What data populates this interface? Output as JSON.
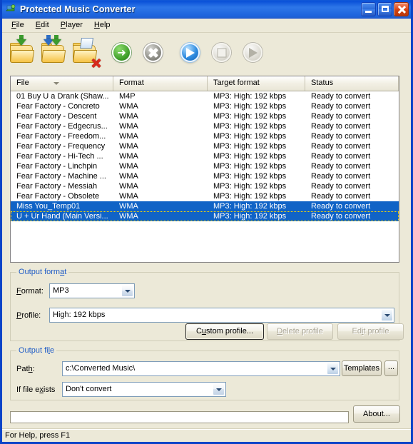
{
  "window": {
    "title": "Protected Music Converter",
    "icon": "app-converter-icon",
    "minimize_label": "Minimize",
    "maximize_label": "Maximize",
    "close_label": "Close"
  },
  "menu": {
    "items": [
      {
        "label": "File",
        "accel": "F"
      },
      {
        "label": "Edit",
        "accel": "E"
      },
      {
        "label": "Player",
        "accel": "P"
      },
      {
        "label": "Help",
        "accel": "H"
      }
    ]
  },
  "toolbar": {
    "buttons": [
      {
        "name": "add-files-icon",
        "tooltip": "Add files"
      },
      {
        "name": "add-folder-icon",
        "tooltip": "Add folder"
      },
      {
        "name": "remove-files-icon",
        "tooltip": "Remove files"
      },
      {
        "name": "convert-icon",
        "tooltip": "Convert"
      },
      {
        "name": "cancel-icon",
        "tooltip": "Cancel"
      },
      {
        "name": "play-icon",
        "tooltip": "Play"
      },
      {
        "name": "stop-icon",
        "tooltip": "Stop"
      },
      {
        "name": "pause-icon",
        "tooltip": "Pause"
      }
    ]
  },
  "file_list": {
    "columns": [
      "File",
      "Format",
      "Target format",
      "Status"
    ],
    "sort_column": "File",
    "sort_direction": "descending",
    "rows": [
      {
        "file": "01 Buy U a Drank (Shaw...",
        "format": "M4P",
        "target": "MP3: High: 192 kbps",
        "status": "Ready to convert",
        "selected": false
      },
      {
        "file": "Fear Factory - Concreto",
        "format": "WMA",
        "target": "MP3: High: 192 kbps",
        "status": "Ready to convert",
        "selected": false
      },
      {
        "file": "Fear Factory - Descent",
        "format": "WMA",
        "target": "MP3: High: 192 kbps",
        "status": "Ready to convert",
        "selected": false
      },
      {
        "file": "Fear Factory - Edgecrus...",
        "format": "WMA",
        "target": "MP3: High: 192 kbps",
        "status": "Ready to convert",
        "selected": false
      },
      {
        "file": "Fear Factory - Freedom...",
        "format": "WMA",
        "target": "MP3: High: 192 kbps",
        "status": "Ready to convert",
        "selected": false
      },
      {
        "file": "Fear Factory - Frequency",
        "format": "WMA",
        "target": "MP3: High: 192 kbps",
        "status": "Ready to convert",
        "selected": false
      },
      {
        "file": "Fear Factory - Hi-Tech ...",
        "format": "WMA",
        "target": "MP3: High: 192 kbps",
        "status": "Ready to convert",
        "selected": false
      },
      {
        "file": "Fear Factory - Linchpin",
        "format": "WMA",
        "target": "MP3: High: 192 kbps",
        "status": "Ready to convert",
        "selected": false
      },
      {
        "file": "Fear Factory - Machine ...",
        "format": "WMA",
        "target": "MP3: High: 192 kbps",
        "status": "Ready to convert",
        "selected": false
      },
      {
        "file": "Fear Factory - Messiah",
        "format": "WMA",
        "target": "MP3: High: 192 kbps",
        "status": "Ready to convert",
        "selected": false
      },
      {
        "file": "Fear Factory - Obsolete",
        "format": "WMA",
        "target": "MP3: High: 192 kbps",
        "status": "Ready to convert",
        "selected": false
      },
      {
        "file": "Miss You_Temp01",
        "format": "WMA",
        "target": "MP3: High: 192 kbps",
        "status": "Ready to convert",
        "selected": true
      },
      {
        "file": "U + Ur Hand (Main Versi...",
        "format": "WMA",
        "target": "MP3: High: 192 kbps",
        "status": "Ready to convert",
        "selected": true
      }
    ]
  },
  "output_format": {
    "legend": "Output format",
    "legend_accel": "a",
    "format_label": "Format:",
    "format_accel": "F",
    "format_value": "MP3",
    "profile_label": "Profile:",
    "profile_accel": "P",
    "profile_value": "High: 192 kbps",
    "custom_profile_button": "Custom profile...",
    "custom_profile_accel": "u",
    "delete_profile_button": "Delete profile",
    "delete_profile_accel": "D",
    "edit_profile_button": "Edit profile",
    "edit_profile_accel": "i"
  },
  "output_file": {
    "legend": "Output file",
    "legend_accel": "l",
    "path_label": "Path:",
    "path_accel": "h",
    "path_value": "c:\\Converted Music\\",
    "templates_button": "Templates",
    "browse_button": "...",
    "if_exists_label": "If file exists",
    "if_exists_accel": "x",
    "if_exists_value": "Don't convert"
  },
  "footer": {
    "progress_value": 0,
    "about_button": "About...",
    "status_text": "For Help, press F1"
  },
  "colors": {
    "titlebar_blue": "#2a72e6",
    "window_face": "#ece9d8",
    "selection_blue": "#1063c6",
    "group_legend": "#215dc6"
  }
}
